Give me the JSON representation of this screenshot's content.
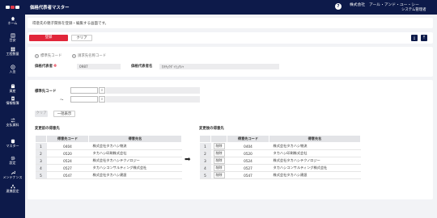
{
  "header": {
    "title": "価格代表者マスター",
    "help_label": "?",
    "company": "株式会社　アール・アンド・ユー・シー",
    "user": "システム管理者"
  },
  "sidebar": {
    "items": [
      {
        "label": "ホーム",
        "icon": "home-icon"
      },
      {
        "label": "目安",
        "icon": "book-icon"
      },
      {
        "label": "工程数量",
        "icon": "grid-icon"
      },
      {
        "label": "入金",
        "icon": "coin-icon"
      },
      {
        "label": "資産",
        "icon": "box-icon"
      },
      {
        "label": "情報帳簿",
        "icon": "ledger-icon"
      },
      {
        "label": "支払資料",
        "icon": "transfer-icon"
      },
      {
        "label": "マスター",
        "icon": "database-icon"
      },
      {
        "label": "設定",
        "icon": "gear-icon"
      },
      {
        "label": "メンテナンス",
        "icon": "wrench-icon"
      },
      {
        "label": "連携設定",
        "icon": "link-icon"
      }
    ]
  },
  "intro": {
    "description": "得意先の親子関係を登録・編集する画面です。"
  },
  "toolbar": {
    "register_label": "登録",
    "clear_label": "クリア",
    "download_icon": "download-icon",
    "upload_icon": "upload-icon"
  },
  "mode": {
    "option_rep": "標準先コード",
    "option_sub": "請求先名称コード"
  },
  "rep": {
    "code_label": "価格代表者",
    "required_mark": "※",
    "code_value": "0987",
    "name_label": "価格代表者名",
    "name_value": "ｶｷﾁｮｳﾀﾞｲﾋｮｳｼｬ"
  },
  "search": {
    "label": "標準先コード",
    "range_sep": "〜",
    "clear_label": "クリア",
    "batch_label": "一括表示"
  },
  "before": {
    "title": "変更前の得意先",
    "headers": [
      "",
      "得意先コード",
      "得意先名"
    ],
    "rows": [
      {
        "no": "1",
        "code": "0404",
        "name": "株式会社タカハシ物流"
      },
      {
        "no": "2",
        "code": "0520",
        "name": "タカハシ印刷株式会社"
      },
      {
        "no": "3",
        "code": "0524",
        "name": "株式会社タカハシテクノロジー"
      },
      {
        "no": "4",
        "code": "0527",
        "name": "タカハシコンサルティング株式会社"
      },
      {
        "no": "5",
        "code": "0547",
        "name": "株式会社タカハシ建設"
      }
    ]
  },
  "arrow": "➡",
  "after": {
    "title": "変更後の得意先",
    "headers": [
      "",
      "",
      "得意先コード",
      "得意先名"
    ],
    "rows": [
      {
        "no": "1",
        "action": "削除",
        "code": "0404",
        "name": "株式会社タカハシ物流"
      },
      {
        "no": "2",
        "action": "削除",
        "code": "0520",
        "name": "タカハシ印刷株式会社"
      },
      {
        "no": "3",
        "action": "削除",
        "code": "0524",
        "name": "株式会社タカハシテクノロジー"
      },
      {
        "no": "4",
        "action": "削除",
        "code": "0527",
        "name": "タカハシコンサルティング株式会社"
      },
      {
        "no": "5",
        "action": "削除",
        "code": "0547",
        "name": "株式会社タカハシ建設"
      }
    ]
  }
}
